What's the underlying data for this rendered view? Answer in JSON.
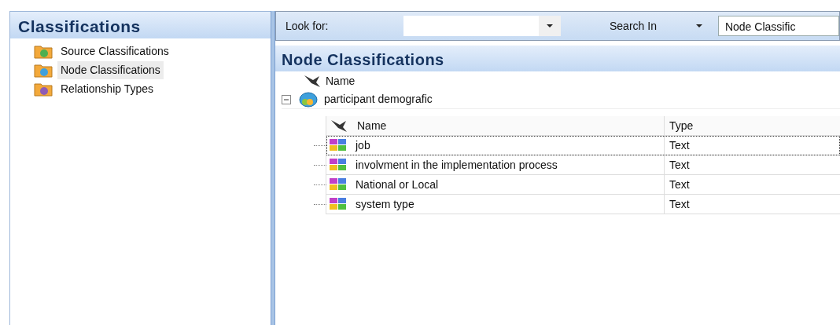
{
  "sidebar": {
    "title": "Classifications",
    "items": [
      {
        "label": "Source Classifications",
        "selected": false,
        "kind": "source"
      },
      {
        "label": "Node Classifications",
        "selected": true,
        "kind": "node"
      },
      {
        "label": "Relationship Types",
        "selected": false,
        "kind": "relationship"
      }
    ]
  },
  "toolbar": {
    "look_for_label": "Look for:",
    "search_in_label": "Search In",
    "search_in_value": "Node Classific"
  },
  "main": {
    "title": "Node Classifications",
    "column": "Name",
    "group": {
      "label": "participant demografic",
      "expanded": true,
      "columns": [
        "Name",
        "Type"
      ],
      "rows": [
        {
          "name": "job",
          "type": "Text",
          "focused": true
        },
        {
          "name": "involvment in the implementation process",
          "type": "Text",
          "focused": false
        },
        {
          "name": "National or Local",
          "type": "Text",
          "focused": false
        },
        {
          "name": "system type",
          "type": "Text",
          "focused": false
        }
      ]
    }
  }
}
